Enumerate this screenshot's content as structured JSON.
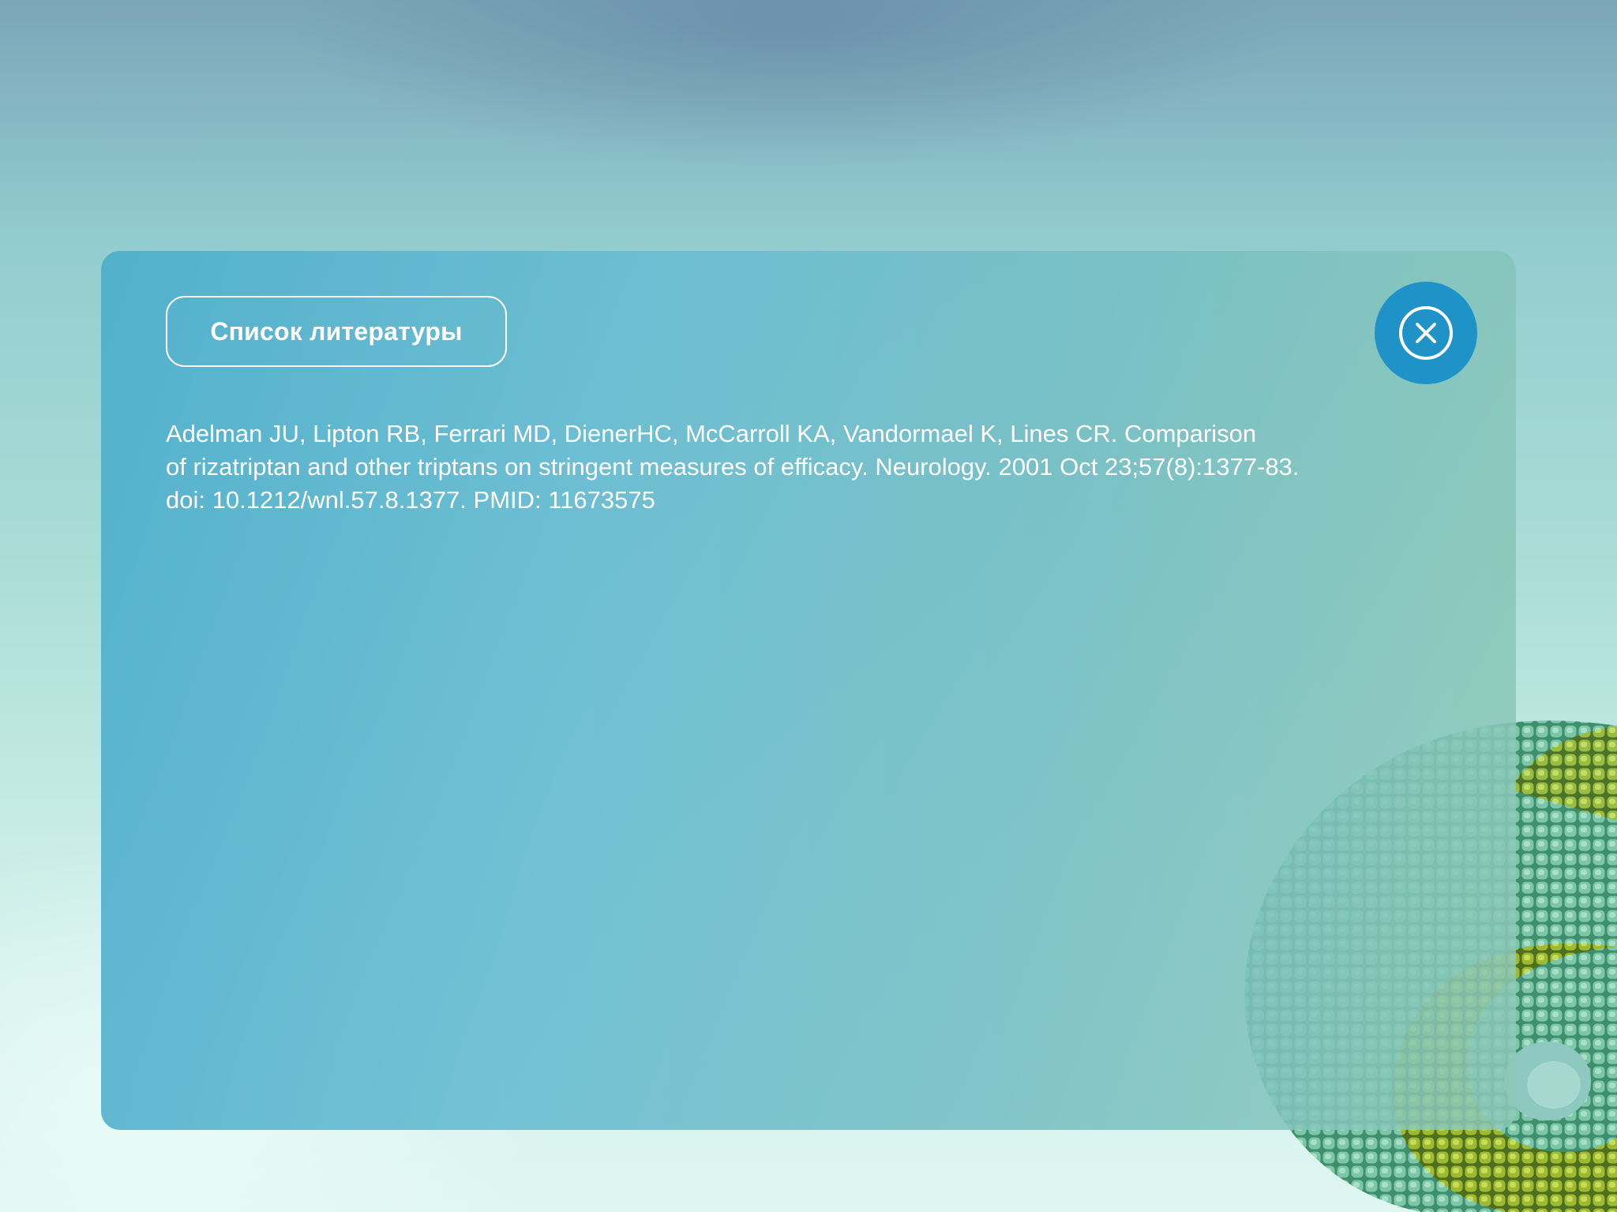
{
  "modal": {
    "title": "Список литературы",
    "close_icon": "close-circle-icon",
    "references": [
      {
        "lines": [
          "Adelman JU, Lipton RB, Ferrari MD, DienerHC, McCarroll KA, Vandormael K, Lines CR. Comparison",
          "of rizatriptan and other triptans on stringent measures of efficacy. Neurology. 2001 Oct 23;57(8):1377-83.",
          "doi: 10.1212/wnl.57.8.1377. PMID: 11673575"
        ]
      }
    ]
  },
  "colors": {
    "close_button": "#1f93c7",
    "text": "#ffffff"
  }
}
